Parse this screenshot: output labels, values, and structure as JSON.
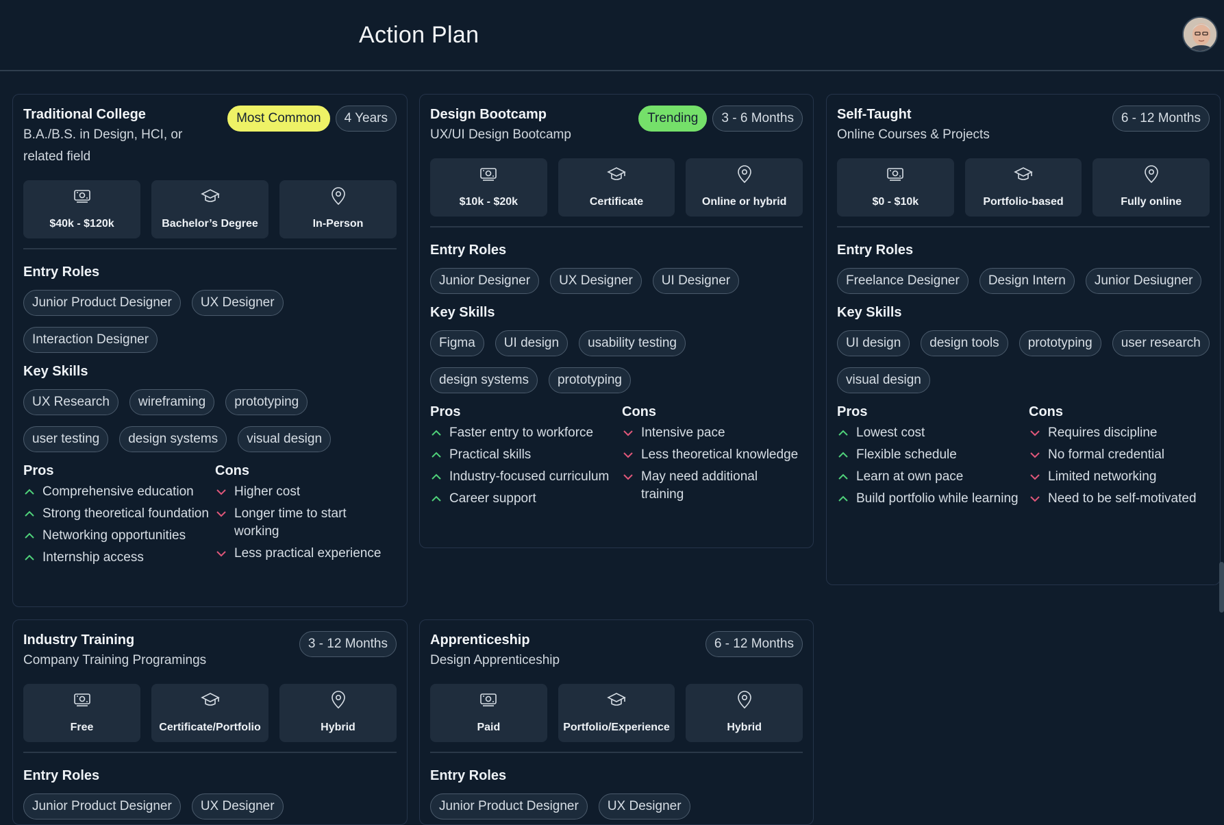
{
  "header": {
    "title": "Action Plan"
  },
  "labels": {
    "entry_roles": "Entry Roles",
    "key_skills": "Key Skills",
    "pros": "Pros",
    "cons": "Cons"
  },
  "cards": [
    {
      "title": "Traditional College",
      "subtitle": "B.A./B.S. in Design, HCI, or related field",
      "badges": [
        {
          "label": "Most Common",
          "style": "yellow"
        },
        {
          "label": "4 Years",
          "style": "outline"
        }
      ],
      "facts": [
        {
          "icon": "money-icon",
          "label": "$40k - $120k"
        },
        {
          "icon": "graduation-cap-icon",
          "label": "Bachelor’s Degree"
        },
        {
          "icon": "location-pin-icon",
          "label": "In-Person"
        }
      ],
      "entry_roles": [
        "Junior Product Designer",
        "UX Designer",
        "Interaction Designer"
      ],
      "key_skills": [
        "UX Research",
        "wireframing",
        "prototyping",
        "user testing",
        "design systems",
        "visual design"
      ],
      "pros": [
        "Comprehensive education",
        "Strong theoretical foundation",
        "Networking opportunities",
        "Internship access"
      ],
      "cons": [
        "Higher cost",
        "Longer time to start working",
        "Less practical experience"
      ]
    },
    {
      "title": "Design Bootcamp",
      "subtitle": "UX/UI Design Bootcamp",
      "badges": [
        {
          "label": "Trending",
          "style": "green"
        },
        {
          "label": "3 - 6 Months",
          "style": "outline"
        }
      ],
      "facts": [
        {
          "icon": "money-icon",
          "label": "$10k - $20k"
        },
        {
          "icon": "graduation-cap-icon",
          "label": "Certificate"
        },
        {
          "icon": "location-pin-icon",
          "label": "Online or hybrid"
        }
      ],
      "entry_roles": [
        "Junior Designer",
        "UX Designer",
        "UI Designer"
      ],
      "key_skills": [
        "Figma",
        "UI design",
        "usability testing",
        "design systems",
        "prototyping"
      ],
      "pros": [
        "Faster entry to workforce",
        "Practical skills",
        "Industry-focused curriculum",
        "Career support"
      ],
      "cons": [
        "Intensive pace",
        "Less theoretical knowledge",
        "May need additional training"
      ]
    },
    {
      "title": "Self-Taught",
      "subtitle": "Online Courses & Projects",
      "badges": [
        {
          "label": "6 - 12 Months",
          "style": "outline"
        }
      ],
      "facts": [
        {
          "icon": "money-icon",
          "label": "$0 - $10k"
        },
        {
          "icon": "graduation-cap-icon",
          "label": "Portfolio-based"
        },
        {
          "icon": "location-pin-icon",
          "label": "Fully online"
        }
      ],
      "entry_roles": [
        "Freelance Designer",
        "Design Intern",
        "Junior Desiugner"
      ],
      "key_skills": [
        "UI design",
        "design tools",
        "prototyping",
        "user research",
        "visual design"
      ],
      "pros": [
        "Lowest cost",
        "Flexible schedule",
        "Learn at own pace",
        "Build portfolio while learning"
      ],
      "cons": [
        "Requires discipline",
        "No formal credential",
        "Limited networking",
        "Need to be self-motivated"
      ]
    },
    {
      "title": "Industry Training",
      "subtitle": "Company Training Programings",
      "badges": [
        {
          "label": "3 - 12 Months",
          "style": "outline"
        }
      ],
      "facts": [
        {
          "icon": "money-icon",
          "label": "Free"
        },
        {
          "icon": "graduation-cap-icon",
          "label": "Certificate/Portfolio"
        },
        {
          "icon": "location-pin-icon",
          "label": "Hybrid"
        }
      ],
      "entry_roles": [
        "Junior Product Designer",
        "UX Designer"
      ],
      "key_skills": [],
      "pros": [],
      "cons": []
    },
    {
      "title": "Apprenticeship",
      "subtitle": "Design Apprenticeship",
      "badges": [
        {
          "label": "6 - 12 Months",
          "style": "outline"
        }
      ],
      "facts": [
        {
          "icon": "money-icon",
          "label": "Paid"
        },
        {
          "icon": "graduation-cap-icon",
          "label": "Portfolio/Experience"
        },
        {
          "icon": "location-pin-icon",
          "label": "Hybrid"
        }
      ],
      "entry_roles": [
        "Junior Product Designer",
        "UX Designer"
      ],
      "key_skills": [],
      "pros": [],
      "cons": []
    }
  ],
  "colors": {
    "background": "#0f1c2b",
    "card_border": "#25344a",
    "tile": "#1f2d3d",
    "chip": "#1c2b3b",
    "pro_check": "#4fd27a",
    "con_chevron": "#e0577a",
    "badge_yellow": "#eef266",
    "badge_green": "#75e06a"
  }
}
